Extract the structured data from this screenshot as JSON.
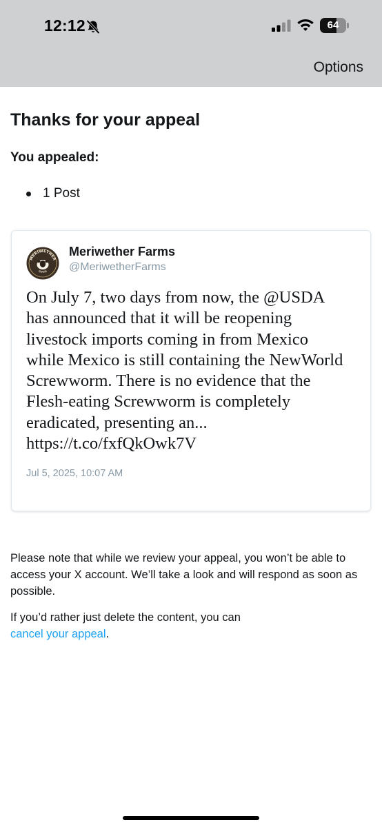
{
  "status_bar": {
    "time": "12:12",
    "battery_level": "64",
    "battery_fraction": 0.64,
    "icons": [
      "bell-slash-icon",
      "cellular-signal-icon",
      "wifi-icon",
      "battery-icon"
    ]
  },
  "header": {
    "options_label": "Options"
  },
  "content": {
    "title": "Thanks for your appeal",
    "subtitle": "You appealed:",
    "appealed_items": [
      "1 Post"
    ]
  },
  "post": {
    "author_name": "Meriwether Farms",
    "author_handle": "@MeriwetherFarms",
    "text": "On July 7, two days from now, the @USDA\nhas announced that it will be reopening\nlivestock imports coming in from Mexico\nwhile Mexico is still containing the NewWorld\nScrewworm. There is no evidence that the\nFlesh-eating Screwworm is completely\neradicated, presenting an...\nhttps://t.co/fxfQkOwk7V",
    "date": "Jul 5, 2025, 10:07 AM",
    "avatar": {
      "logo_text_top": "MERIWETHER",
      "logo_text_bottom": "FARMS"
    }
  },
  "footer": {
    "note": "Please note that while we review your appeal, you won’t be able to access your X account. We’ll take a look and will respond as soon as possible.",
    "cancel_prefix": "If you’d rather just delete the content, you can",
    "cancel_link": "cancel your appeal",
    "cancel_suffix": "."
  },
  "colors": {
    "top_bar": "#cfd0d2",
    "link": "#1da1f2",
    "secondary_text": "#8899a6",
    "card_border": "#e1e8ed"
  }
}
